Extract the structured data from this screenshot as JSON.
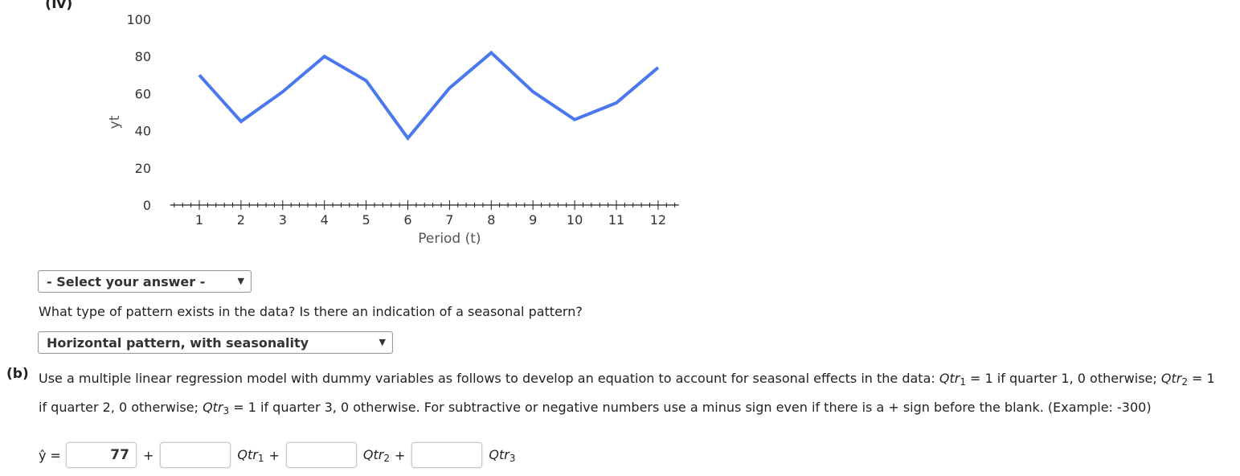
{
  "part_label": "(iv)",
  "chart_data": {
    "type": "line",
    "title": "",
    "xlabel": "Period (t)",
    "ylabel": "yt",
    "x": [
      1,
      2,
      3,
      4,
      5,
      6,
      7,
      8,
      9,
      10,
      11,
      12
    ],
    "values": [
      70,
      45,
      61,
      80,
      67,
      36,
      63,
      82,
      61,
      46,
      55,
      74
    ],
    "xlim": [
      0.3,
      12.5
    ],
    "ylim": [
      0,
      100
    ],
    "yticks": [
      0,
      20,
      40,
      60,
      80,
      100
    ],
    "xticks": [
      1,
      2,
      3,
      4,
      5,
      6,
      7,
      8,
      9,
      10,
      11,
      12
    ],
    "minor_ticks_per_unit": 5,
    "grid": false,
    "series_color": "#4a78ee"
  },
  "select1": {
    "value": "- Select your answer -",
    "arrow": "▼"
  },
  "question": "What type of pattern exists in the data? Is there an indication of a seasonal pattern?",
  "select2": {
    "value": "Horizontal pattern, with seasonality",
    "arrow": "▼"
  },
  "part_b": {
    "label": "(b)",
    "text_1": "Use a multiple linear regression model with dummy variables as follows to develop an equation to account for seasonal effects in the data: ",
    "q1_var": "Qtr",
    "q1_sub": "1",
    "text_2": " = 1 if quarter 1, 0 otherwise; ",
    "q2_var": "Qtr",
    "q2_sub": "2",
    "text_3": " = 1 if quarter 2, 0 otherwise; ",
    "q3_var": "Qtr",
    "q3_sub": "3",
    "text_4": " = 1 if quarter 3, 0 otherwise. For subtractive or negative numbers use a minus sign even if there is a + sign before the blank. (Example: -300)"
  },
  "equation": {
    "lhs": "ŷ =",
    "intercept": "77",
    "plus": "+",
    "coef1": "",
    "coef2": "",
    "coef3": "",
    "var": "Qtr",
    "sub1": "1",
    "sub2": "2",
    "sub3": "3"
  }
}
